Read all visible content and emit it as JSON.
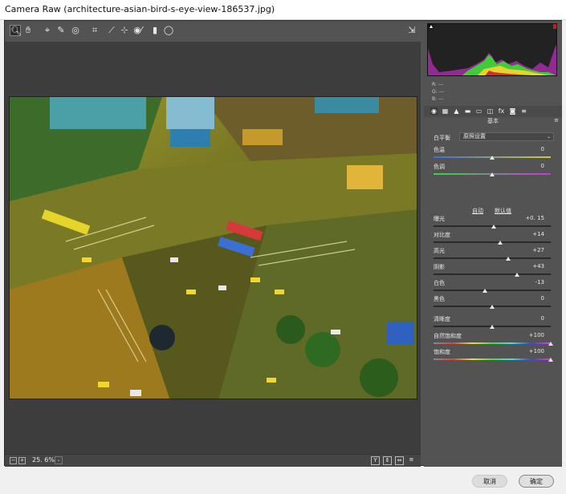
{
  "window": {
    "title": "Camera Raw (architecture-asian-bird-s-eye-view-186537.jpg)"
  },
  "toolbar": {
    "tools": [
      {
        "name": "zoom-tool-icon",
        "glyph": "🔍︎"
      },
      {
        "name": "hand-tool-icon",
        "glyph": "✋︎"
      },
      {
        "name": "white-balance-tool-icon",
        "glyph": "⌖"
      },
      {
        "name": "color-sampler-tool-icon",
        "glyph": "✎"
      },
      {
        "name": "targeted-adjustment-tool-icon",
        "glyph": "◎"
      },
      {
        "name": "crop-tool-icon",
        "glyph": "⌗"
      },
      {
        "name": "straighten-tool-icon",
        "glyph": "⟋"
      },
      {
        "name": "spot-removal-tool-icon",
        "glyph": "⊹"
      },
      {
        "name": "red-eye-removal-tool-icon",
        "glyph": "◉"
      },
      {
        "name": "adjustment-brush-icon",
        "glyph": "⁄"
      },
      {
        "name": "graduated-filter-icon",
        "glyph": "▮"
      },
      {
        "name": "radial-filter-icon",
        "glyph": "◯"
      }
    ],
    "fullscreen_icon": "⇲"
  },
  "status": {
    "zoom": "25. 6%",
    "zoom_minus": "−",
    "zoom_plus": "+",
    "zoom_dropdown": "⌄",
    "right_icons": [
      "Y",
      "⇕",
      "⇔",
      "≡"
    ]
  },
  "histogram": {
    "rgb_labels": [
      "R:  ---",
      "G:  ---",
      "B:  ---"
    ]
  },
  "panel_tabs": [
    "◉",
    "▦",
    "▲",
    "▬",
    "▭",
    "◫",
    "fx",
    "◙",
    "≡"
  ],
  "basic": {
    "section_title": "基本",
    "white_balance_label": "白平衡",
    "white_balance_value": "原照设置",
    "auto": "自动",
    "default": "默认值",
    "sliders": [
      {
        "label": "色温",
        "value": "0",
        "pos": 0.5
      },
      {
        "label": "色调",
        "value": "0",
        "pos": 0.5
      },
      {
        "label": "曝光",
        "value": "+0. 15",
        "pos": 0.515
      },
      {
        "label": "对比度",
        "value": "+14",
        "pos": 0.57
      },
      {
        "label": "高光",
        "value": "+27",
        "pos": 0.635
      },
      {
        "label": "阴影",
        "value": "+43",
        "pos": 0.715
      },
      {
        "label": "白色",
        "value": "-13",
        "pos": 0.435
      },
      {
        "label": "黑色",
        "value": "0",
        "pos": 0.5
      },
      {
        "label": "清晰度",
        "value": "0",
        "pos": 0.5
      },
      {
        "label": "自然饱和度",
        "value": "+100",
        "pos": 1.0
      },
      {
        "label": "饱和度",
        "value": "+100",
        "pos": 1.0
      }
    ]
  },
  "footer": {
    "cancel": "取消",
    "ok": "确定"
  },
  "colors": {
    "panel": "#535353",
    "canvas": "#3d3d3d",
    "accent_green": "#42c93c",
    "accent_yellow": "#e7d42a"
  }
}
